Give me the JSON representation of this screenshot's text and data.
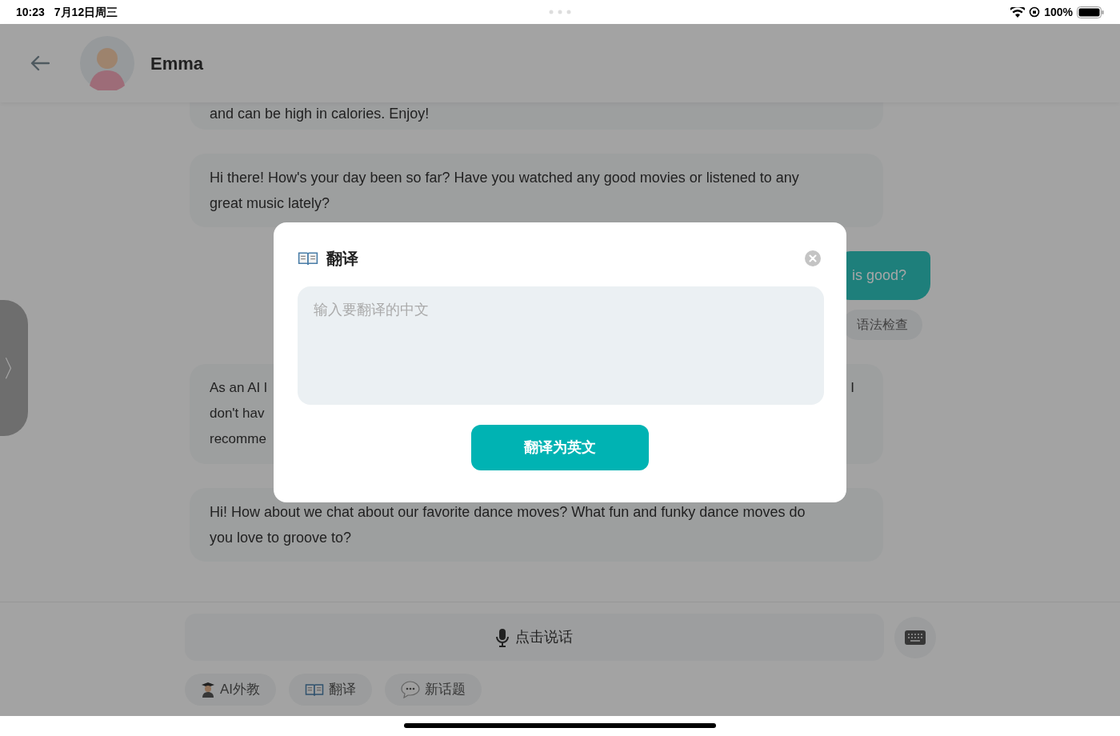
{
  "status_bar": {
    "time": "10:23",
    "date": "7月12日周三",
    "battery": "100%"
  },
  "header": {
    "name": "Emma"
  },
  "side_tab": {
    "label": "〉"
  },
  "messages": [
    {
      "kind": "ai_top",
      "lines": [
        "and can be high in calories. Enjoy!"
      ]
    },
    {
      "kind": "ai",
      "lines": [
        "Hi there! How's your day been so far? Have you watched any good movies or listened to any",
        "great music lately?"
      ]
    },
    {
      "kind": "user",
      "text": "is good?",
      "action": "语法检查"
    },
    {
      "kind": "ai_partial",
      "left_lines": [
        "As an AI l",
        "don't hav",
        "recomme"
      ],
      "right_lines": [
        "I"
      ]
    },
    {
      "kind": "ai",
      "lines": [
        "Hi! How about we chat about our favorite dance moves? What fun and funky dance moves do",
        "you love to groove to?"
      ]
    }
  ],
  "dialog": {
    "title": "翻译",
    "placeholder": "输入要翻译的中文",
    "button": "翻译为英文"
  },
  "bottom_bar": {
    "voice_button": "点击说话",
    "chips": [
      {
        "kind": "teacher",
        "label": "AI外教"
      },
      {
        "kind": "translate",
        "label": "翻译"
      },
      {
        "kind": "topic",
        "label": "新话题"
      }
    ]
  }
}
